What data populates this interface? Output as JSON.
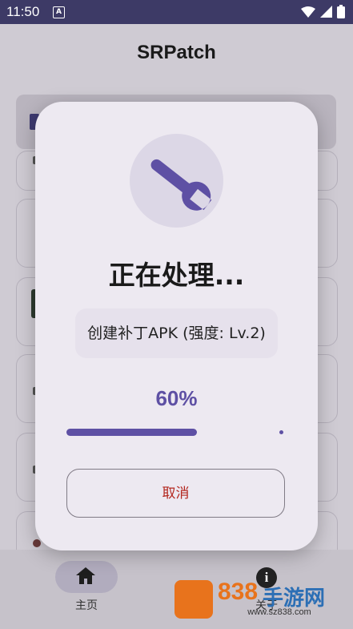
{
  "status_bar": {
    "time": "11:50",
    "notification_icon": "A"
  },
  "app": {
    "title": "SRPatch"
  },
  "dialog": {
    "icon": "wrench-icon",
    "title": "正在处理...",
    "detail": "创建补丁APK (强度: Lv.2)",
    "progress_percent_text": "60%",
    "progress_value": 0.6,
    "cancel_label": "取消"
  },
  "bottom_nav": {
    "items": [
      {
        "label": "主页",
        "icon": "home-icon",
        "selected": true
      },
      {
        "label": "关于",
        "icon": "info-icon",
        "selected": false
      }
    ]
  },
  "watermark": {
    "number": "838",
    "text": "手游网",
    "url": "www.sz838.com"
  },
  "colors": {
    "accent": "#5e50a4",
    "cancel": "#b3261e",
    "status_bar": "#3d3a66"
  }
}
